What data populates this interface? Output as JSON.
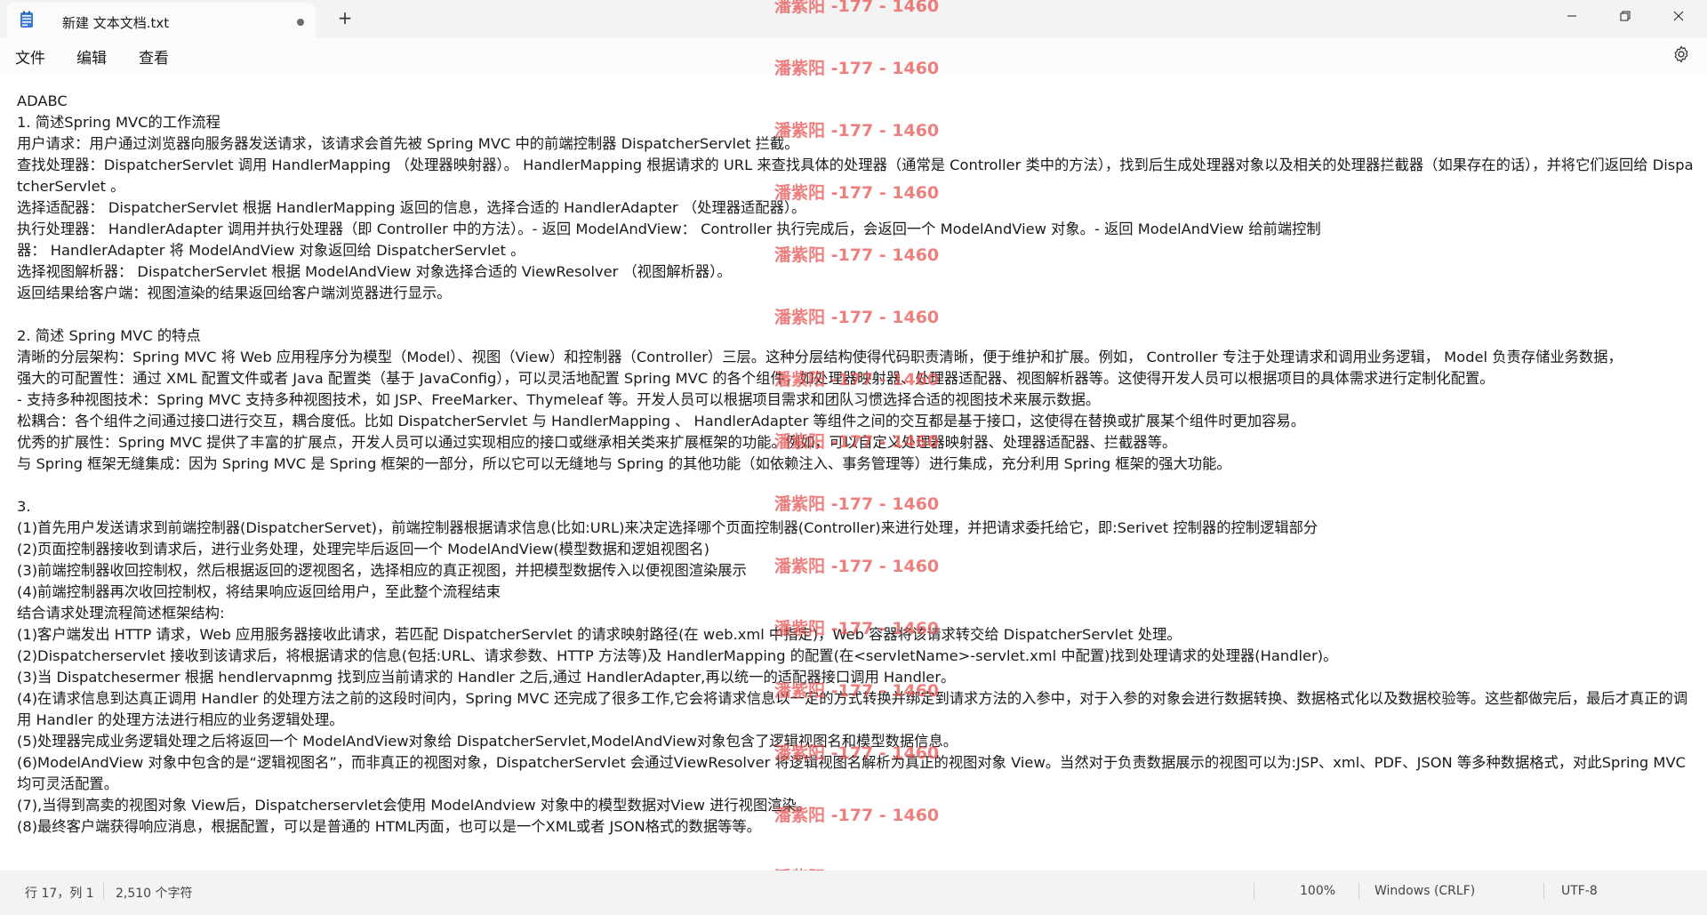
{
  "window": {
    "tab_title": "新建 文本文档.txt",
    "new_tab_symbol": "+"
  },
  "menu": {
    "file": "文件",
    "edit": "编辑",
    "view": "查看"
  },
  "editor": {
    "lines": [
      "ADABC",
      "1. 简述Spring MVC的工作流程",
      "用户请求：用户通过浏览器向服务器发送请求，该请求会首先被 Spring MVC 中的前端控制器 DispatcherServlet 拦截。",
      "查找处理器：DispatcherServlet 调用 HandlerMapping （处理器映射器）。 HandlerMapping 根据请求的 URL 来查找具体的处理器（通常是 Controller 类中的方法），找到后生成处理器对象以及相关的处理器拦截器（如果存在的话），并将它们返回给 DispatcherServlet 。",
      "选择适配器： DispatcherServlet 根据 HandlerMapping 返回的信息，选择合适的 HandlerAdapter （处理器适配器）。",
      "执行处理器： HandlerAdapter 调用并执行处理器（即 Controller 中的方法）。- 返回 ModelAndView： Controller 执行完成后，会返回一个 ModelAndView 对象。- 返回 ModelAndView 给前端控制",
      "器： HandlerAdapter 将 ModelAndView 对象返回给 DispatcherServlet 。",
      "选择视图解析器： DispatcherServlet 根据 ModelAndView 对象选择合适的 ViewResolver （视图解析器）。",
      "返回结果给客户端：视图渲染的结果返回给客户端浏览器进行显示。",
      "",
      "2. 简述 Spring MVC 的特点",
      "清晰的分层架构：Spring MVC 将 Web 应用程序分为模型（Model）、视图（View）和控制器（Controller）三层。这种分层结构使得代码职责清晰，便于维护和扩展。例如， Controller 专注于处理请求和调用业务逻辑， Model 负责存储业务数据，",
      "强大的可配置性：通过 XML 配置文件或者 Java 配置类（基于 JavaConfig），可以灵活地配置 Spring MVC 的各个组件，如处理器映射器、处理器适配器、视图解析器等。这使得开发人员可以根据项目的具体需求进行定制化配置。",
      "- 支持多种视图技术：Spring MVC 支持多种视图技术，如 JSP、FreeMarker、Thymeleaf 等。开发人员可以根据项目需求和团队习惯选择合适的视图技术来展示数据。",
      "松耦合：各个组件之间通过接口进行交互，耦合度低。比如 DispatcherServlet 与 HandlerMapping 、 HandlerAdapter 等组件之间的交互都是基于接口，这使得在替换或扩展某个组件时更加容易。",
      "优秀的扩展性：Spring MVC 提供了丰富的扩展点，开发人员可以通过实现相应的接口或继承相关类来扩展框架的功能。例如，可以自定义处理器映射器、处理器适配器、拦截器等。",
      "与 Spring 框架无缝集成：因为 Spring MVC 是 Spring 框架的一部分，所以它可以无缝地与 Spring 的其他功能（如依赖注入、事务管理等）进行集成，充分利用 Spring 框架的强大功能。",
      "",
      "3.",
      "(1)首先用户发送请求到前端控制器(DispatcherServet)，前端控制器根据请求信息(比如:URL)来决定选择哪个页面控制器(Controller)来进行处理，并把请求委托给它，即:Serivet 控制器的控制逻辑部分",
      "(2)页面控制器接收到请求后，进行业务处理，处理完毕后返回一个 ModelAndView(模型数据和逻姐视图名)",
      "(3)前端控制器收回控制权，然后根据返回的逻视图名，选择相应的真正视图，并把模型数据传入以便视图渲染展示",
      "(4)前端控制器再次收回控制权，将结果响应返回给用户，至此整个流程结束",
      "结合请求处理流程简述框架结构:",
      "(1)客户端发出 HTTP 请求，Web 应用服务器接收此请求，若匹配 DispatcherServlet 的请求映射路径(在 web.xml 中指定)，Web 容器将该请求转交给 DispatcherServlet 处理。",
      "(2)Dispatcherservlet 接收到该请求后，将根据请求的信息(包括:URL、请求参数、HTTP 方法等)及 HandlerMapping 的配置(在<servletName>-servlet.xml 中配置)找到处理请求的处理器(Handler)。",
      "(3)当 Dispatchesermer 根据 hendlervapnmg 找到应当前请求的 Handler 之后,通过 HandlerAdapter,再以统一的适配器接口调用 Handler。",
      "(4)在请求信息到达真正调用 Handler 的处理方法之前的这段时间内，Spring MVC 还完成了很多工作,它会将请求信息以一定的方式转换并绑定到请求方法的入参中，对于入参的对象会进行数据转换、数据格式化以及数据校验等。这些都做完后，最后才真正的调用 Handler 的处理方法进行相应的业务逻辑处理。",
      "(5)处理器完成业务逻辑处理之后将返回一个 ModelAndView对象给 DispatcherServlet,ModelAndView对象包含了逻辑视图名和模型数据信息。",
      "(6)ModelAndView 对象中包含的是“逻辑视图名”，而非真正的视图对象，DispatcherServlet 会通过ViewResolver 将逻辑视图名解析为真正的视图对象 View。当然对于负责数据展示的视图可以为:JSP、xml、PDF、JSON 等多种数据格式，对此Spring MVC 均可灵活配置。",
      "(7),当得到高卖的视图对象 View后，Dispatcherservlet会使用 ModelAndview 对象中的模型数据对View 进行视图渲染。",
      "(8)最终客户端获得响应消息，根据配置，可以是普通的 HTML丙面，也可以是一个XML或者 JSON格式的数据等等。"
    ]
  },
  "watermark": {
    "text": "潘紫阳 -177 - 1460",
    "color": "#e85454"
  },
  "statusbar": {
    "position": "行 17，列 1",
    "char_count": "2,510 个字符",
    "zoom": "100%",
    "line_ending": "Windows (CRLF)",
    "encoding": "UTF-8"
  }
}
